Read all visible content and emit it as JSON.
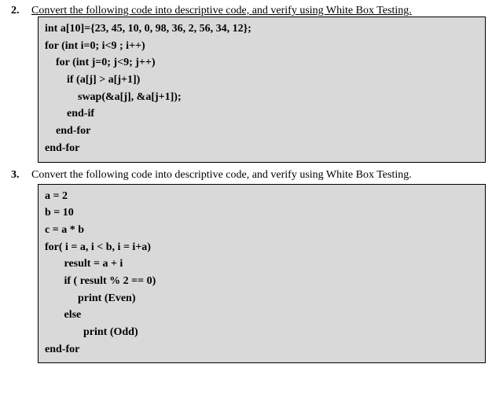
{
  "q2": {
    "number": "2.",
    "prompt": "Convert the following code into descriptive code, and verify using White Box Testing.",
    "code": [
      "int a[10]={23, 45, 10, 0, 98, 36, 2, 56, 34, 12};",
      "for (int i=0; i<9 ; i++)",
      "    for (int j=0; j<9; j++)",
      "        if (a[j] > a[j+1])",
      "            swap(&a[j], &a[j+1]);",
      "        end-if",
      "    end-for",
      "end-for"
    ]
  },
  "q3": {
    "number": "3.",
    "prompt": "Convert the following code into descriptive code, and verify using White Box Testing.",
    "code": [
      "a = 2",
      "b = 10",
      "c = a * b",
      "for( i = a, i < b, i = i+a)",
      "       result = a + i",
      "       if ( result % 2 == 0)",
      "            print (Even)",
      "       else",
      "              print (Odd)",
      "end-for"
    ]
  }
}
